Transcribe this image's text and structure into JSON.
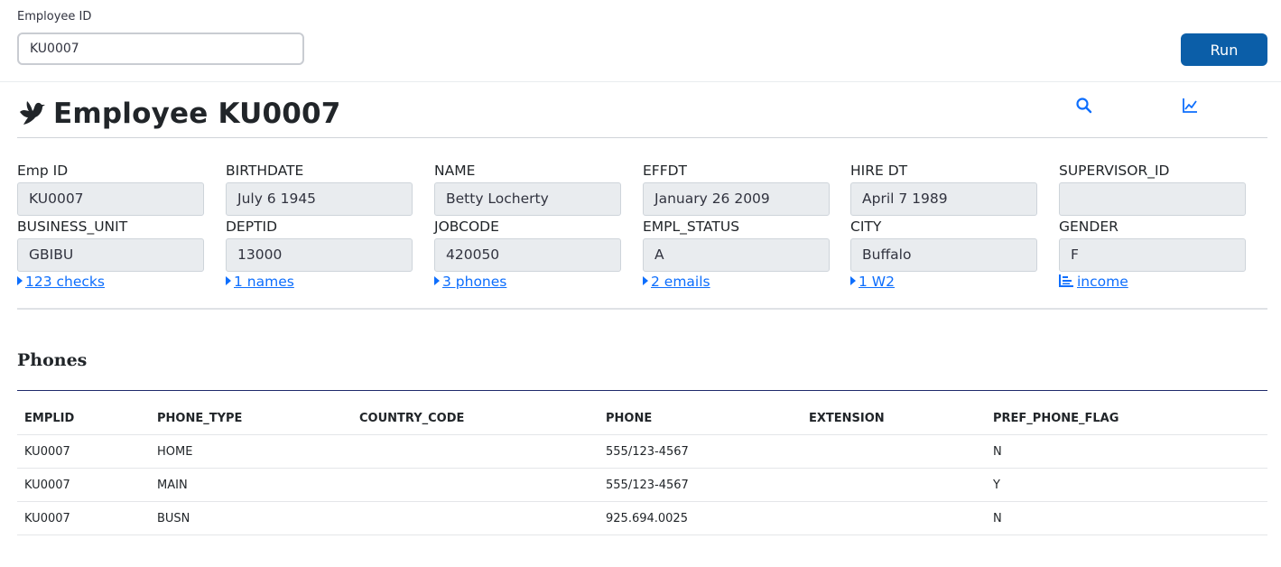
{
  "query": {
    "employee_id_label": "Employee ID",
    "employee_id_value": "KU0007",
    "run_label": "Run"
  },
  "header": {
    "title": "Employee KU0007",
    "icons": [
      "bird-icon",
      "search-icon",
      "chart-line-icon"
    ],
    "accent_color": "#0d6efd",
    "button_color": "#0b5ea8"
  },
  "fields": [
    {
      "label": "Emp ID",
      "value": "KU0007"
    },
    {
      "label": "BIRTHDATE",
      "value": "July 6 1945"
    },
    {
      "label": "NAME",
      "value": "Betty Locherty"
    },
    {
      "label": "EFFDT",
      "value": "January 26 2009"
    },
    {
      "label": "HIRE DT",
      "value": "April 7 1989"
    },
    {
      "label": "SUPERVISOR_ID",
      "value": ""
    },
    {
      "label": "BUSINESS_UNIT",
      "value": "GBIBU"
    },
    {
      "label": "DEPTID",
      "value": "13000"
    },
    {
      "label": "JOBCODE",
      "value": "420050"
    },
    {
      "label": "EMPL_STATUS",
      "value": "A"
    },
    {
      "label": "CITY",
      "value": "Buffalo"
    },
    {
      "label": "GENDER",
      "value": "F"
    }
  ],
  "links": [
    {
      "label": "123 checks",
      "icon": "caret-right-icon"
    },
    {
      "label": "1 names",
      "icon": "caret-right-icon"
    },
    {
      "label": "3 phones",
      "icon": "caret-right-icon"
    },
    {
      "label": "2 emails",
      "icon": "caret-right-icon"
    },
    {
      "label": "1 W2",
      "icon": "caret-right-icon"
    },
    {
      "label": "income",
      "icon": "bar-chart-icon"
    }
  ],
  "phones": {
    "title": "Phones",
    "columns": [
      "EMPLID",
      "PHONE_TYPE",
      "COUNTRY_CODE",
      "PHONE",
      "EXTENSION",
      "PREF_PHONE_FLAG"
    ],
    "rows": [
      [
        "KU0007",
        "HOME",
        "",
        "555/123-4567",
        "",
        "N"
      ],
      [
        "KU0007",
        "MAIN",
        "",
        "555/123-4567",
        "",
        "Y"
      ],
      [
        "KU0007",
        "BUSN",
        "",
        "925.694.0025",
        "",
        "N"
      ]
    ]
  }
}
